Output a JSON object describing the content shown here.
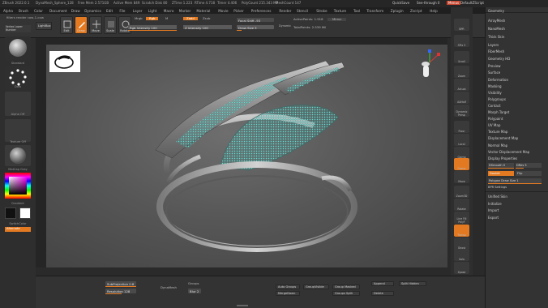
{
  "titlebar": {
    "app": "ZBrush 2022.0.1",
    "document": "DynaMesh_Sphere_128",
    "free_mem": "Free Mem 2.571GB",
    "active_mem": "Active Mem 849",
    "scratch_disk": "Scratch Disk 80",
    "ztime": "ZTime 1.223",
    "rtime": "RTime 4.718",
    "timer": "Timer 4.406",
    "polycount": "PolyCount 215.343 MP",
    "meshcount": "MeshCount 147",
    "quicksave": "QuickSave",
    "see_through": "See-through 0",
    "menus": "Menus",
    "default_script": "DefaultZScript"
  },
  "menubar": [
    "Alpha",
    "Brush",
    "Color",
    "Document",
    "Draw",
    "Dynamics",
    "Edit",
    "File",
    "Layer",
    "Light",
    "Macro",
    "Marker",
    "Material",
    "Movie",
    "Picker",
    "Preferences",
    "Render",
    "Stencil",
    "Stroke",
    "Texture",
    "Tool",
    "Transform",
    "Zplugin",
    "Zscript",
    "Help"
  ],
  "toolbar": {
    "render_label": "filters render cow-1-cow",
    "lightbox": "LightBox",
    "edit": "Edit",
    "draw": "Draw",
    "move": "Move",
    "scale": "Scale",
    "rotate": "Rotate",
    "mrgb": "Mrgb",
    "rgb": "Rgb",
    "m": "M",
    "rgb_intensity": "Rgb Intensity 100",
    "zadd": "Zadd",
    "zsub": "Zsub",
    "z_intensity": "Z Intensity 100",
    "focal_shift": "Focal Shift -93",
    "draw_size": "Draw Size 3",
    "dynamic": "Dynamic",
    "active_points": "ActivePoints: 1.918",
    "total_points": "TotalPoints: 2.539 Mil",
    "mirror": "Mirror"
  },
  "leftshelf": {
    "top_buttons": "Vertex Lower Number",
    "brush": "Standard",
    "stroke": "Dots",
    "alpha": "Alpha Off",
    "texture": "Texture Off",
    "material": "MatCap Gray",
    "gradient": "Gradient",
    "switch_color": "SwitchColor",
    "alternate": "Alternate"
  },
  "rightshelf": [
    "BPR",
    "SPix 3",
    "Scroll",
    "Zoom",
    "Actual",
    "AAHalf",
    "Dynamic Persp",
    "Floor",
    "Local",
    "Gizmo",
    "Frame",
    "Move",
    "Zoom3D",
    "Rotate",
    "Line Fill PolyF",
    "Transp",
    "Ghost",
    "Solo",
    "Xpose"
  ],
  "rightpanel": {
    "items": [
      "Geometry",
      "ArrayMesh",
      "NanoMesh",
      "Thick Skin",
      "Layers",
      "FiberMesh",
      "Geometry HD",
      "Preview",
      "Surface",
      "Deformation",
      "Masking",
      "Visibility",
      "Polygroups",
      "Contact",
      "Morph Target",
      "Polypaint",
      "UV Map",
      "Texture Map",
      "Displacement Map",
      "Normal Map",
      "Vector Displacement Map",
      "Display Properties"
    ],
    "dp_smooth": "DSmooth 0",
    "dp_dres": "DRes 5",
    "double": "Double",
    "flip": "Flip",
    "polygroup_ratio": "Polygon Draw Size 1",
    "bpr_settings": "BPR Settings",
    "unified_skin": "Unified Skin",
    "initialize": "Initialize",
    "import": "Import",
    "export": "Export"
  },
  "bottombar": {
    "sdiv": "SubProjection 0.8",
    "resolution": "Resolution 128",
    "dynamesh": "DynaMesh",
    "groups": "Groups",
    "blur": "Blur 2",
    "auto_groups": "Auto Groups",
    "group_visible": "GroupVisible",
    "groups_masked": "Group Masked",
    "append": "Append",
    "merge_down": "MergeDown",
    "groups_split": "Groups Split",
    "delete": "Delete",
    "extract": "Extract",
    "split_hidden": "Split Hidden"
  },
  "colors": {
    "accent": "#e37a22",
    "highlight_red": "#c7462f",
    "panel": "#333333",
    "canvas": "#5a5a5a"
  }
}
